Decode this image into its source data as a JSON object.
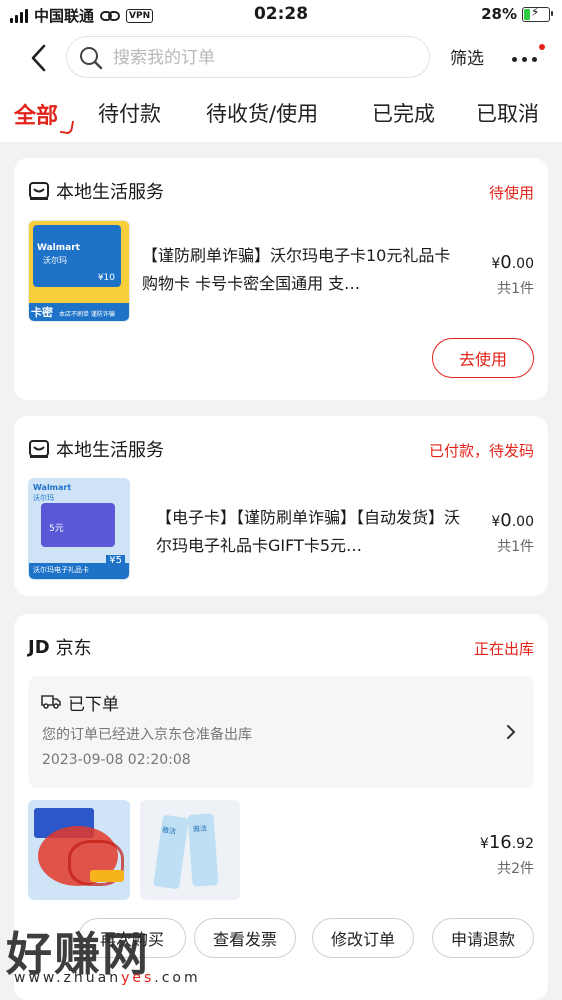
{
  "status_bar": {
    "carrier": "中国联通",
    "vpn": "VPN",
    "time": "02:28",
    "battery": "28%",
    "battery_level_percent": 28
  },
  "header": {
    "search_placeholder": "搜索我的订单",
    "filter_label": "筛选"
  },
  "tabs": [
    "全部",
    "待付款",
    "待收货/使用",
    "已完成",
    "已取消"
  ],
  "active_tab": 0,
  "orders": [
    {
      "shop": "本地生活服务",
      "status": "待使用",
      "title": "【谨防刷单诈骗】沃尔玛电子卡10元礼品卡 购物卡 卡号卡密全国通用 支…",
      "price_currency": "¥",
      "price_int": "0",
      "price_dec": ".00",
      "qty": "共1件",
      "action": "去使用",
      "thumb": {
        "brand": "Walmart",
        "brand_cn": "沃尔玛",
        "badge": "卡密",
        "amount": "¥10",
        "footer": "本店不刷单 谨防诈骗"
      }
    },
    {
      "shop": "本地生活服务",
      "status": "已付款，待发码",
      "title": "【电子卡】【谨防刷单诈骗】【自动发货】沃尔玛电子礼品卡GIFT卡5元…",
      "price_currency": "¥",
      "price_int": "0",
      "price_dec": ".00",
      "qty": "共1件",
      "thumb": {
        "brand": "Walmart",
        "brand_cn": "沃尔玛",
        "amount_big": "5元",
        "footer": "沃尔玛电子礼品卡",
        "amount": "¥5"
      }
    },
    {
      "shop": "京东",
      "shop_logo": "JD",
      "status": "正在出库",
      "track_title": "已下单",
      "track_desc": "您的订单已经进入京东仓准备出库",
      "track_time": "2023-09-08 02:20:08",
      "price_currency": "¥",
      "price_int": "16",
      "price_dec": ".92",
      "qty": "共2件",
      "product2_brand": "雅洁",
      "buttons": [
        "再次购买",
        "查看发票",
        "修改订单",
        "申请退款"
      ]
    }
  ],
  "watermark": {
    "text": "好赚网",
    "url_prefix": "www.zhuan",
    "url_accent": "yes",
    "url_suffix": ".com"
  },
  "colors": {
    "accent": "#e2231a",
    "background": "#f2f2f2",
    "card": "#ffffff"
  }
}
